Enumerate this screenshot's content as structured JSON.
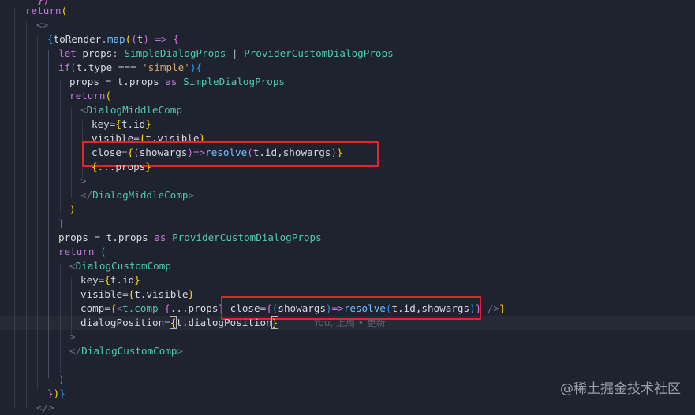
{
  "code": {
    "l0": "})",
    "l1_return": "return",
    "l2_frag": "<>",
    "l3_map": "toRender",
    "l3_map_fn": "map",
    "l3_param": "t",
    "l4_let": "let",
    "l4_props": "props",
    "l4_type1": "SimpleDialogProps",
    "l4_type2": "ProviderCustomDialogProps",
    "l5_if": "if",
    "l5_cond": "t.type === ",
    "l5_str": "'simple'",
    "l6_assign": "props = t.props ",
    "l6_as": "as",
    "l6_type": "SimpleDialogProps",
    "l7_return": "return",
    "l8_tag": "DialogMiddleComp",
    "l9_attr": "key",
    "l9_val": "t.id",
    "l10_attr": "visible",
    "l10_val": "t.visible",
    "l11_attr": "close",
    "l11_arg": "showargs",
    "l11_fn": "resolve",
    "l11_args": "t.id,showargs",
    "l12_spread": "...props",
    "l14_tag": "DialogMiddleComp",
    "l17_assign": "props = t.props ",
    "l17_as": "as",
    "l17_type": "ProviderCustomDialogProps",
    "l18_return": "return",
    "l19_tag": "DialogCustomComp",
    "l20_attr": "key",
    "l20_val": "t.id",
    "l21_attr": "visible",
    "l21_val": "t.visible",
    "l22_attr": "comp",
    "l22_tag": "t.comp",
    "l22_spread": "...props",
    "l22_close": "close",
    "l22_arg": "showargs",
    "l22_fn": "resolve",
    "l22_args": "t.id,showargs",
    "l23_attr": "dialogPosition",
    "l23_val": "t.dialogPosition",
    "l25_tag": "DialogCustomComp"
  },
  "blame": "You, 上周 • 更新",
  "watermark": "@稀土掘金技术社区",
  "colors": {
    "background": "#1f2330",
    "highlight_box": "#e0262a"
  }
}
